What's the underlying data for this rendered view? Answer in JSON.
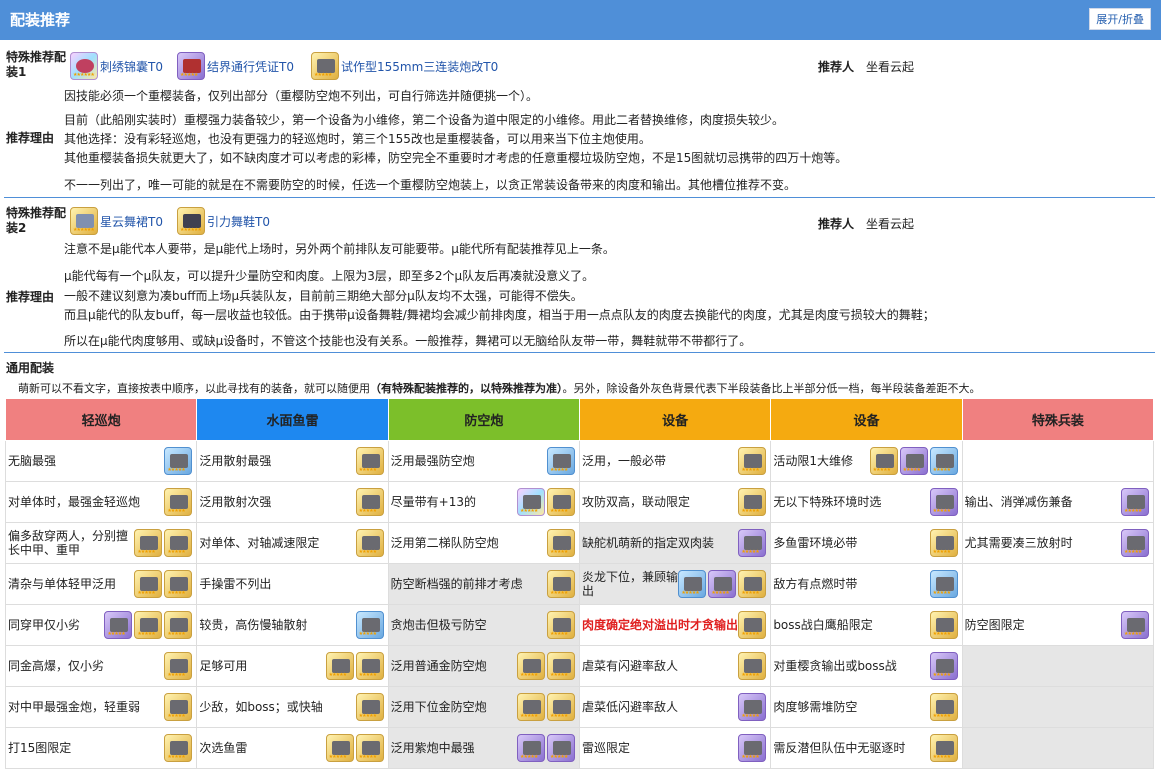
{
  "header": {
    "title": "配装推荐",
    "toggle": "展开/折叠"
  },
  "special1": {
    "label": "特殊推荐配装1",
    "items": [
      "刺绣锦囊T0",
      "结界通行凭证T0",
      "试作型155mm三连装炮改T0"
    ],
    "recommender_label": "推荐人",
    "recommender": "坐看云起",
    "reason_label": "推荐理由",
    "lines": [
      "因技能必须一个重樱装备，仅列出部分（重樱防空炮不列出，可自行筛选并随便挑一个）。",
      "目前（此船刚实装时）重樱强力装备较少，第一个设备为小维修，第二个设备为道中限定的小维修。用此二者替换维修，肉度损失较少。",
      "其他选择：没有彩轻巡炮，也没有更强力的轻巡炮时，第三个155改也是重樱装备，可以用来当下位主炮使用。",
      "其他重樱装备损失就更大了，如不缺肉度才可以考虑的彩棒，防空完全不重要时才考虑的任意重樱垃圾防空炮，不是15图就切忌携带的四万十炮等。",
      "不一一列出了，唯一可能的就是在不需要防空的时候，任选一个重樱防空炮装上，以贪正常装设备带来的肉度和输出。其他槽位推荐不变。"
    ]
  },
  "special2": {
    "label": "特殊推荐配装2",
    "items": [
      "星云舞裙T0",
      "引力舞鞋T0"
    ],
    "recommender_label": "推荐人",
    "recommender": "坐看云起",
    "reason_label": "推荐理由",
    "lines": [
      "注意不是μ能代本人要带，是μ能代上场时，另外两个前排队友可能要带。μ能代所有配装推荐见上一条。",
      "μ能代每有一个μ队友，可以提升少量防空和肉度。上限为3层，即至多2个μ队友后再凑就没意义了。",
      "一般不建议刻意为凑buff而上场μ兵装队友，目前前三期绝大部分μ队友均不太强，可能得不偿失。",
      "而且μ能代的队友buff，每一层收益也较低。由于携带μ设备舞鞋/舞裙均会减少前排肉度，相当于用一点点队友的肉度去换能代的肉度，尤其是肉度亏损较大的舞鞋；",
      "所以在μ能代肉度够用、或缺μ设备时，不管这个技能也没有关系。一般推荐，舞裙可以无脑给队友带一带，舞鞋就带不带都行了。"
    ]
  },
  "general": {
    "title": "通用配装",
    "note_a": "萌新可以不看文字，直接按表中顺序，以此寻找有的装备，就可以随便用",
    "note_b": "（有特殊配装推荐的，以特殊推荐为准）",
    "note_c": "。另外，除设备外灰色背景代表下半段装备比上半部分低一档，每半段装备差距不大。",
    "columns": [
      {
        "name": "轻巡炮",
        "color": "#f08080"
      },
      {
        "name": "水面鱼雷",
        "color": "#1e88f0"
      },
      {
        "name": "防空炮",
        "color": "#7cbf2a"
      },
      {
        "name": "设备",
        "color": "#f5aa10"
      },
      {
        "name": "设备",
        "color": "#f5aa10"
      },
      {
        "name": "特殊兵装",
        "color": "#f08080"
      }
    ],
    "rows": [
      [
        "无脑最强",
        "泛用散射最强",
        "泛用最强防空炮",
        "泛用，一般必带",
        "活动限1大维修",
        ""
      ],
      [
        "对单体时，最强金轻巡炮",
        "泛用散射次强",
        "尽量带有+13的",
        "攻防双高，联动限定",
        "无以下特殊环境时选",
        "输出、消弹减伤兼备"
      ],
      [
        "偏多敌穿两人，分别擅长中甲、重甲",
        "对单体、对轴减速限定",
        "泛用第二梯队防空炮",
        "缺舵机萌新的指定双肉装",
        "多鱼雷环境必带",
        "尤其需要凑三放射时"
      ],
      [
        "清杂与单体轻甲泛用",
        "手操雷不列出",
        "防空断档强的前排才考虑",
        "炎龙下位，兼顾输出",
        "敌方有点燃时带",
        ""
      ],
      [
        "同穿甲仅小劣",
        "较贵，高伤慢轴散射",
        "贪炮击但极亏防空",
        "肉度确定绝对溢出时才贪输出",
        "boss战白鹰船限定",
        "防空图限定"
      ],
      [
        "同金高爆，仅小劣",
        "足够可用",
        "泛用普通金防空炮",
        "虐菜有闪避率敌人",
        "对重樱贪输出或boss战",
        ""
      ],
      [
        "对中甲最强金炮，轻重弱",
        "少敌，如boss；或快轴",
        "泛用下位金防空炮",
        "虐菜低闪避率敌人",
        "肉度够需堆防空",
        ""
      ],
      [
        "打15图限定",
        "次选鱼雷",
        "泛用紫炮中最强",
        "雷巡限定",
        "需反潜但队伍中无驱逐时",
        ""
      ]
    ],
    "icons": [
      [
        [
          "blue"
        ],
        [
          "gold"
        ],
        [
          "blue"
        ],
        [
          "gold"
        ],
        [
          "gold",
          "purple",
          "blue"
        ],
        []
      ],
      [
        [
          "gold"
        ],
        [
          "gold"
        ],
        [
          "rain",
          "gold"
        ],
        [
          "gold"
        ],
        [
          "purple"
        ],
        [
          "purple"
        ]
      ],
      [
        [
          "gold",
          "gold"
        ],
        [
          "gold"
        ],
        [
          "gold"
        ],
        [
          "purple"
        ],
        [
          "gold"
        ],
        [
          "purple"
        ]
      ],
      [
        [
          "gold",
          "gold"
        ],
        [],
        [
          "gold"
        ],
        [
          "blue",
          "purple",
          "gold"
        ],
        [
          "blue"
        ],
        []
      ],
      [
        [
          "purple",
          "gold",
          "gold"
        ],
        [
          "blue"
        ],
        [
          "gold"
        ],
        [
          "gold"
        ],
        [
          "gold"
        ],
        [
          "purple"
        ]
      ],
      [
        [
          "gold"
        ],
        [
          "gold",
          "gold"
        ],
        [
          "gold",
          "gold"
        ],
        [
          "gold"
        ],
        [
          "purple"
        ],
        []
      ],
      [
        [
          "gold"
        ],
        [
          "gold"
        ],
        [
          "gold",
          "gold"
        ],
        [
          "purple"
        ],
        [
          "gold"
        ],
        []
      ],
      [
        [
          "gold"
        ],
        [
          "gold",
          "gold"
        ],
        [
          "purple",
          "purple"
        ],
        [
          "purple"
        ],
        [
          "gold"
        ],
        []
      ]
    ]
  }
}
